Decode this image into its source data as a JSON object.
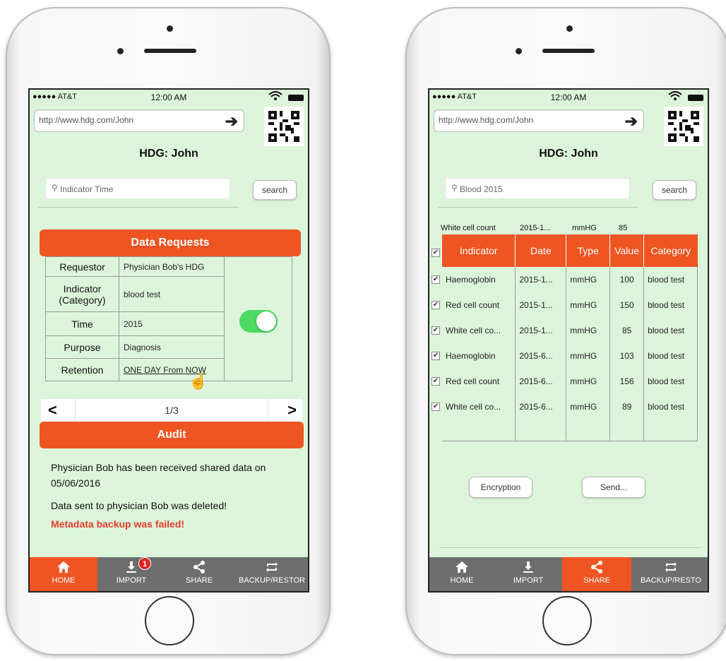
{
  "left_phone": {
    "status": {
      "carrier": "●●●●● AT&T",
      "time": "12:00 AM"
    },
    "url": "http://www.hdg.com/John",
    "title": "HDG: John",
    "search": {
      "placeholder": "Indicator Time",
      "button": "search"
    },
    "data_requests": {
      "header": "Data Requests",
      "rows": [
        {
          "key": "Requestor",
          "value": "Physician Bob's HDG"
        },
        {
          "key": "Indicator (Category)",
          "value": "blood test"
        },
        {
          "key": "Time",
          "value": "2015"
        },
        {
          "key": "Purpose",
          "value": "Diagnosis"
        },
        {
          "key": "Retention",
          "value": "ONE DAY From NOW"
        }
      ],
      "toggle_on": true
    },
    "pager": {
      "prev": "<",
      "page": "1/3",
      "next": ">"
    },
    "audit_label": "Audit",
    "messages": [
      "Physician Bob has been received shared data on 05/06/2016",
      "Data sent to physician Bob was deleted!"
    ],
    "error_message": "Metadata backup was failed!",
    "tabs": [
      {
        "label": "HOME",
        "icon": "home-icon",
        "active": true
      },
      {
        "label": "IMPORT",
        "icon": "download-icon",
        "badge": "1"
      },
      {
        "label": "SHARE",
        "icon": "share-icon"
      },
      {
        "label": "BACKUP/RESTOR",
        "icon": "sync-icon"
      }
    ],
    "colors": {
      "accent": "#ee5522",
      "screen_bg": "#dcf5da",
      "error": "#e53a2a",
      "toggle": "#4cd964"
    }
  },
  "right_phone": {
    "status": {
      "carrier": "●●●●● AT&T",
      "time": "12:00 AM"
    },
    "url": "http://www.hdg.com/John",
    "title": "HDG: John",
    "search": {
      "value": "Blood  2015",
      "button": "search"
    },
    "above_row": [
      "White cell count",
      "2015-1...",
      "mmHG",
      "85"
    ],
    "table": {
      "headers": [
        "Indicator",
        "Date",
        "Type",
        "Value",
        "Category"
      ],
      "rows": [
        [
          "Haemoglobin",
          "2015-1...",
          "mmHG",
          "100",
          "blood test"
        ],
        [
          "Red cell count",
          "2015-1...",
          "mmHG",
          "150",
          "blood test"
        ],
        [
          "White cell co...",
          "2015-1...",
          "mmHG",
          "85",
          "blood test"
        ],
        [
          "Haemoglobin",
          "2015-6...",
          "mmHG",
          "103",
          "blood test"
        ],
        [
          "Red cell count",
          "2015-6...",
          "mmHG",
          "156",
          "blood test"
        ],
        [
          "White cell co...",
          "2015-6...",
          "mmHG",
          "89",
          "blood test"
        ]
      ]
    },
    "buttons": {
      "encryption": "Encryption",
      "send": "Send..."
    },
    "tabs": [
      {
        "label": "HOME",
        "icon": "home-icon"
      },
      {
        "label": "IMPORT",
        "icon": "download-icon"
      },
      {
        "label": "SHARE",
        "icon": "share-icon",
        "active": true
      },
      {
        "label": "BACKUP/RESTO",
        "icon": "sync-icon"
      }
    ]
  }
}
